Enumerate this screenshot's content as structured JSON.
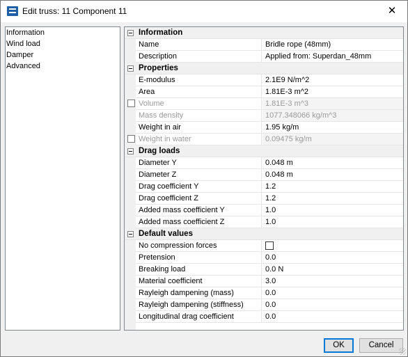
{
  "window": {
    "title": "Edit truss: 11 Component 11",
    "close_glyph": "✕"
  },
  "nav": {
    "items": [
      "Information",
      "Wind load",
      "Damper",
      "Advanced"
    ]
  },
  "grid": {
    "sections": [
      {
        "title": "Information",
        "rows": [
          {
            "name": "Name",
            "value": "Bridle rope (48mm)"
          },
          {
            "name": "Description",
            "value": "Applied from: Superdan_48mm"
          }
        ]
      },
      {
        "title": "Properties",
        "rows": [
          {
            "name": "E-modulus",
            "value": "2.1E9 N/m^2"
          },
          {
            "name": "Area",
            "value": "1.81E-3 m^2"
          },
          {
            "name": "Volume",
            "value": "1.81E-3 m^3",
            "disabled": true,
            "checkbox": true
          },
          {
            "name": "Mass density",
            "value": "1077.348066 kg/m^3",
            "disabled": true
          },
          {
            "name": "Weight in air",
            "value": "1.95 kg/m"
          },
          {
            "name": "Weight in water",
            "value": "0.09475 kg/m",
            "disabled": true,
            "checkbox": true
          }
        ]
      },
      {
        "title": "Drag loads",
        "rows": [
          {
            "name": "Diameter Y",
            "value": "0.048 m"
          },
          {
            "name": "Diameter Z",
            "value": "0.048 m"
          },
          {
            "name": "Drag coefficient Y",
            "value": "1.2"
          },
          {
            "name": "Drag coefficient Z",
            "value": "1.2"
          },
          {
            "name": "Added mass coefficient Y",
            "value": "1.0"
          },
          {
            "name": "Added mass coefficient Z",
            "value": "1.0"
          }
        ]
      },
      {
        "title": "Default values",
        "rows": [
          {
            "name": "No compression forces",
            "value": "",
            "value_checkbox": true
          },
          {
            "name": "Pretension",
            "value": "0.0"
          },
          {
            "name": "Breaking load",
            "value": "0.0 N"
          },
          {
            "name": "Material coefficient",
            "value": "3.0"
          },
          {
            "name": "Rayleigh dampening (mass)",
            "value": "0.0"
          },
          {
            "name": "Rayleigh dampening (stiffness)",
            "value": "0.0"
          },
          {
            "name": "Longitudinal drag coefficient",
            "value": "0.0"
          }
        ]
      }
    ]
  },
  "buttons": {
    "ok": "OK",
    "cancel": "Cancel"
  }
}
